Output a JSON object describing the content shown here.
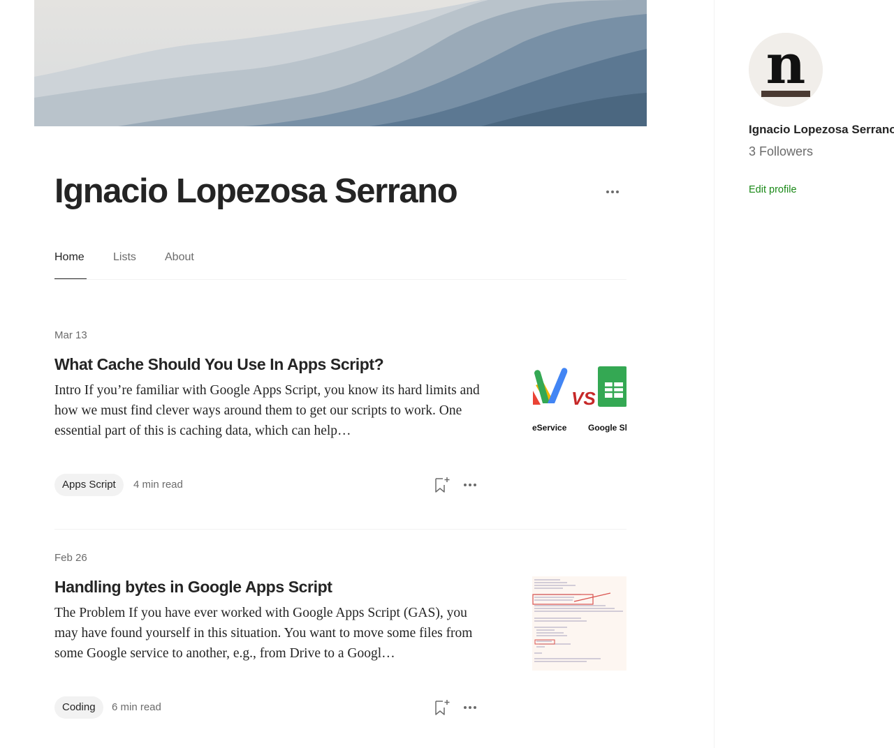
{
  "profile": {
    "name": "Ignacio Lopezosa Serrano"
  },
  "tabs": [
    {
      "label": "Home"
    },
    {
      "label": "Lists"
    },
    {
      "label": "About"
    }
  ],
  "articles": [
    {
      "date": "Mar 13",
      "title": "What Cache Should You Use In Apps Script?",
      "excerpt": "Intro If you’re familiar with Google Apps Script, you know its hard limits and how we must find clever ways around them to get our scripts to work. One essential part of this is caching data, which can help…",
      "tag": "Apps Script",
      "read_time": "4 min read",
      "thumbnail": {
        "vs_text": "VS",
        "left_label": "eService",
        "right_label": "Google Sh"
      }
    },
    {
      "date": "Feb 26",
      "title": "Handling bytes in Google Apps Script",
      "excerpt": "The Problem If you have ever worked with Google Apps Script (GAS), you may have found yourself in this situation. You want to move some files from some Google service to another, e.g., from Drive to a Googl…",
      "tag": "Coding",
      "read_time": "6 min read"
    }
  ],
  "sidebar": {
    "name": "Ignacio Lopezosa Serrano",
    "followers": "3 Followers",
    "edit_profile": "Edit profile",
    "avatar_letter": "n"
  },
  "colors": {
    "accent_green": "#1a8917",
    "text_primary": "#242424",
    "text_muted": "#6b6b6b",
    "divider": "#f2f2f2",
    "tag_bg": "#f2f2f2"
  },
  "icons": {
    "more": "more-horizontal-icon",
    "bookmark": "bookmark-add-icon"
  }
}
